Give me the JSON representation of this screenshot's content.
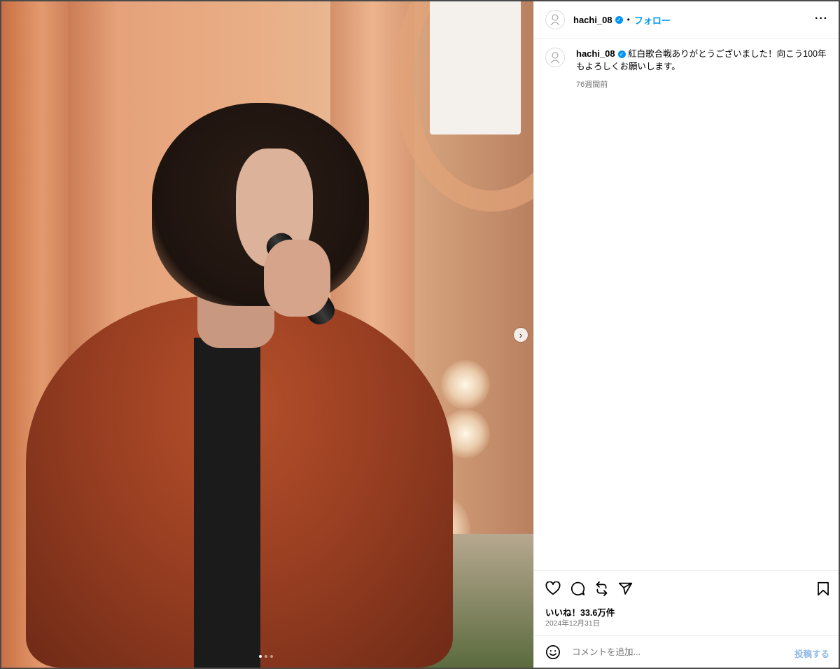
{
  "post": {
    "username": "hachi_08",
    "separator": "•",
    "follow_label": "フォロー",
    "more_label": "···",
    "verified_glyph": "✓",
    "caption": "紅白歌合戦ありがとうございました！向こう100年もよろしくお願いします。",
    "caption_age": "76週間前",
    "likes": "いいね！33.6万件",
    "date": "2024年12月31日",
    "comment_placeholder": "コメントを追加...",
    "post_button": "投稿する",
    "carousel_next": "›",
    "carousel_total": 3,
    "carousel_index": 1
  },
  "icons": {
    "avatar": "avatar-icon",
    "verified": "verified-badge-icon",
    "like": "heart-icon",
    "comment": "comment-icon",
    "repost": "repost-icon",
    "share": "share-icon",
    "save": "bookmark-icon",
    "emoji": "emoji-icon"
  },
  "colors": {
    "accent": "#0095f6",
    "muted": "#737373",
    "post_button_disabled": "#8fb9e6"
  }
}
